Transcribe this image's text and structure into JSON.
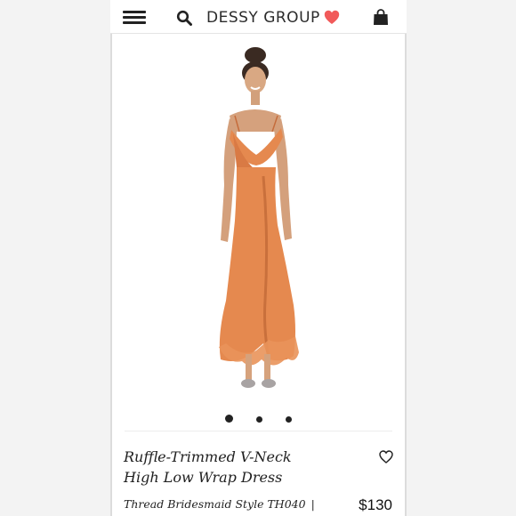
{
  "header": {
    "brand": "DESSY GROUP",
    "icons": [
      "menu-icon",
      "search-icon",
      "heart-icon",
      "shopping-bag-icon"
    ],
    "heart_color": "#f15a5a"
  },
  "product": {
    "title_line1": "Ruffle-Trimmed V-Neck",
    "title_line2": "High Low Wrap Dress",
    "style_label": "Thread Bridesmaid Style TH040",
    "separator": "|",
    "price": "$130",
    "dress_color": "#e5894f"
  },
  "carousel": {
    "slides": 3,
    "active_index": 0
  }
}
